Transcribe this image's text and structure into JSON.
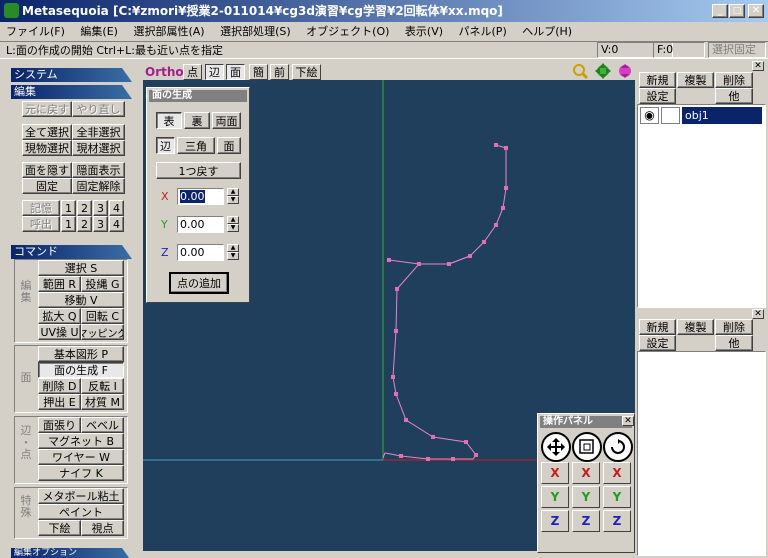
{
  "window": {
    "title": "Metasequoia [C:¥zmori¥授業2-011014¥cg3d演習¥cg学習¥2回転体¥xx.mqo]"
  },
  "menu": [
    "ファイル(F)",
    "編集(E)",
    "選択部属性(A)",
    "選択部処理(S)",
    "オブジェクト(O)",
    "表示(V)",
    "パネル(P)",
    "ヘルプ(H)"
  ],
  "status": {
    "hint": "L:面の作成の開始  Ctrl+L:最も近い点を指定",
    "v": "V:0",
    "f": "F:0",
    "lock": "選択固定"
  },
  "left": {
    "system": "システム",
    "edit": "編集",
    "undo": "元に戻す",
    "redo": "やり直し",
    "sel_all": "全て選択",
    "sel_none": "全非選択",
    "sel_obj": "現物選択",
    "sel_mat": "現材選択",
    "hide": "面を隠す",
    "show": "隠面表示",
    "fix": "固定",
    "unfix": "固定解除",
    "memory": "記憶",
    "recall": "呼出",
    "nums": [
      "1",
      "2",
      "3",
      "4"
    ],
    "command": "コマンド",
    "edit_group": "編集",
    "select": "選択 S",
    "range": "範囲 R",
    "lasso": "投縄 G",
    "move": "移動 V",
    "scale": "拡大 Q",
    "rotate": "回転 C",
    "uv": "UV操 U",
    "mapping": "マッピング",
    "face_group": "面",
    "primitive": "基本図形 P",
    "face_create": "面の生成 F",
    "delete": "削除 D",
    "invert": "反転 I",
    "extrude": "押出 E",
    "material": "材質 M",
    "edge_group": "辺・点",
    "stretch": "面張り",
    "bevel": "ベベル",
    "magnet": "マグネット B",
    "wire": "ワイヤー W",
    "knife": "ナイフ K",
    "special_group": "特殊",
    "metaball": "メタボール粘土",
    "paint": "ペイント",
    "sketch": "下絵",
    "viewpoint": "視点",
    "bottom": "編集オプション"
  },
  "view": {
    "ortho": "Ortho",
    "point": "点",
    "edge": "辺",
    "face": "面",
    "simple": "簡",
    "front": "前",
    "underlay": "下絵"
  },
  "face_panel": {
    "title": "面の生成",
    "front": "表",
    "back": "裏",
    "both": "両面",
    "edge": "辺",
    "tri": "三角",
    "face": "面",
    "undo": "1つ戻す",
    "x_label": "X",
    "y_label": "Y",
    "z_label": "Z",
    "x_value": "0.00",
    "y_value": "0.00",
    "z_value": "0.00",
    "add_point": "点の追加"
  },
  "obj_panel": {
    "new": "新規",
    "copy": "複製",
    "delete": "削除",
    "settings": "設定",
    "other": "他",
    "object": "obj1"
  },
  "mat_panel": {
    "new": "新規",
    "copy": "複製",
    "delete": "削除",
    "settings": "設定",
    "other": "他"
  },
  "op_panel": {
    "title": "操作パネル",
    "x": "X",
    "y": "Y",
    "z": "Z"
  },
  "colors": {
    "viewport": "#1f3f5c",
    "y_axis": "#2fb52f",
    "x_axis": "#3aa0c0",
    "x_axis_pos": "#c02020",
    "curve": "#e884c8",
    "vertex": "#e070b0"
  }
}
